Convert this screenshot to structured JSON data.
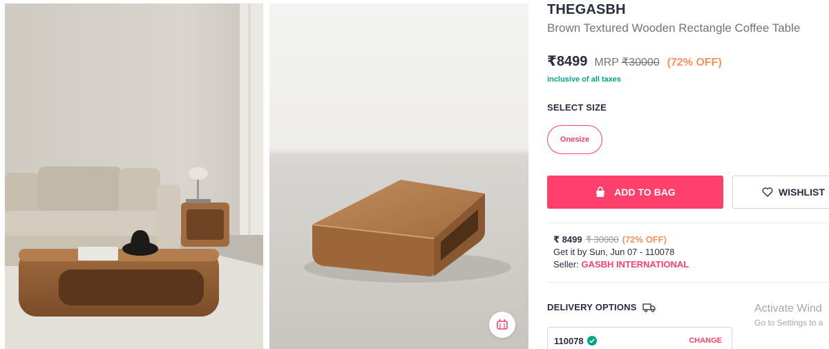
{
  "product": {
    "brand": "THEGASBH",
    "title": "Brown Textured Wooden Rectangle Coffee Table"
  },
  "pricing": {
    "price": "₹8499",
    "mrp_label": "MRP",
    "mrp": "₹30000",
    "discount": "(72% OFF)",
    "taxes_note": "inclusive of all taxes"
  },
  "size": {
    "heading": "SELECT SIZE",
    "options": [
      "Onesize"
    ],
    "selected": "Onesize"
  },
  "actions": {
    "add_to_bag": "ADD TO BAG",
    "wishlist": "WISHLIST"
  },
  "offer": {
    "price": "₹ 8499",
    "mrp": "₹ 30000",
    "discount": "(72% OFF)",
    "delivery_eta": "Get it by Sun, Jun 07 - 110078",
    "seller_label": "Seller:",
    "seller_name": "GASBH INTERNATIONAL"
  },
  "delivery": {
    "heading": "DELIVERY OPTIONS",
    "pincode": "110078",
    "change_label": "CHANGE"
  },
  "watermark": {
    "line1": "Activate Wind",
    "line2": "Go to Settings to a"
  },
  "colors": {
    "accent": "#ff3f6c",
    "discount": "#ff905a",
    "success": "#03a685",
    "text": "#282c3f",
    "muted": "#737373"
  },
  "icons": {
    "bag": "bag-icon",
    "heart": "heart-icon",
    "truck": "truck-icon",
    "verified": "check-circle-icon",
    "similar": "view-similar-icon"
  }
}
